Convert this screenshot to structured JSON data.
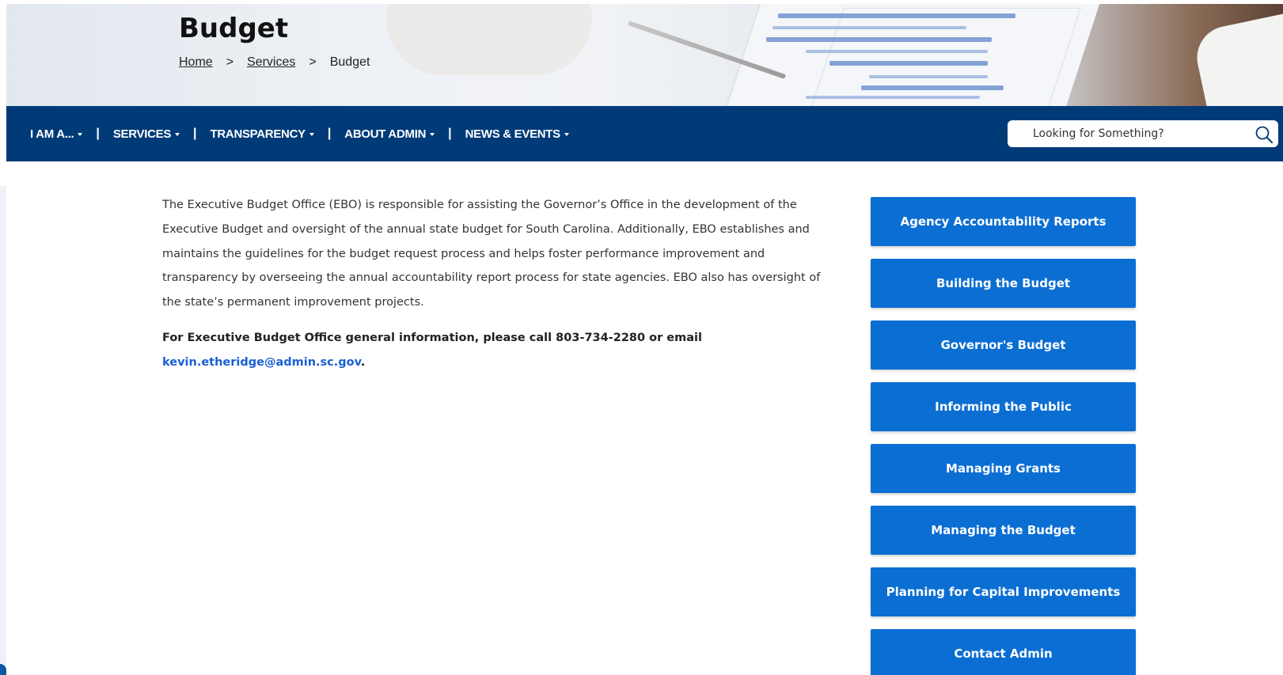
{
  "header": {
    "title": "Budget",
    "breadcrumb": {
      "home": "Home",
      "separator": ">",
      "services": "Services",
      "current": "Budget"
    }
  },
  "nav": {
    "items": [
      {
        "label": "I AM A..."
      },
      {
        "label": "SERVICES"
      },
      {
        "label": "TRANSPARENCY"
      },
      {
        "label": "ABOUT ADMIN"
      },
      {
        "label": "NEWS & EVENTS"
      }
    ],
    "divider": "|",
    "search_placeholder": "Looking for Something?"
  },
  "main": {
    "intro": "The Executive Budget Office (EBO) is responsible for assisting the Governor’s Office in the development of the Executive Budget and oversight of the annual state budget for South Carolina. Additionally, EBO establishes and maintains the guidelines for the budget request process and helps foster performance improvement and transparency by overseeing the annual accountability report process for state agencies. EBO also has oversight of the state’s permanent improvement projects.",
    "contact_text": "For Executive Budget Office general information, please call 803-734-2280 or email",
    "contact_email": "kevin.etheridge@admin.sc.gov",
    "contact_end": "."
  },
  "sidebar": {
    "buttons": [
      {
        "label": "Agency Accountability Reports"
      },
      {
        "label": "Building the Budget"
      },
      {
        "label": "Governor's Budget"
      },
      {
        "label": "Informing the Public"
      },
      {
        "label": "Managing Grants"
      },
      {
        "label": "Managing the Budget"
      },
      {
        "label": "Planning for Capital Improvements"
      },
      {
        "label": "Contact Admin"
      }
    ]
  },
  "colors": {
    "nav_bg": "#003b78",
    "button_bg": "#0b6ed3",
    "link": "#1a5fd6"
  }
}
